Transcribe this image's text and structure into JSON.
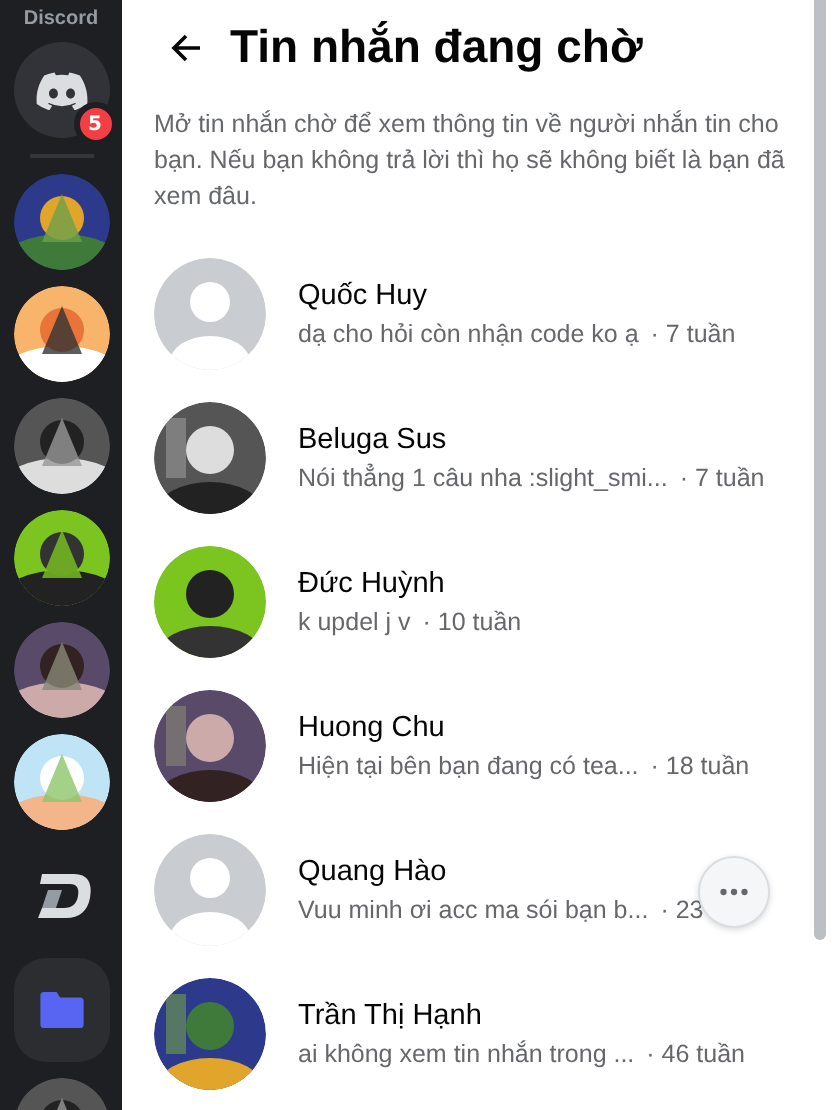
{
  "sidebar": {
    "brand": "Discord",
    "items": [
      {
        "kind": "logo",
        "badge": "5"
      },
      {
        "kind": "picture"
      },
      {
        "kind": "picture"
      },
      {
        "kind": "picture"
      },
      {
        "kind": "picture"
      },
      {
        "kind": "picture"
      },
      {
        "kind": "picture"
      },
      {
        "kind": "d-logo"
      },
      {
        "kind": "folder"
      },
      {
        "kind": "picture"
      }
    ]
  },
  "header": {
    "title": "Tin nhắn đang chờ"
  },
  "description": "Mở tin nhắn chờ để xem thông tin về người nhắn tin cho bạn. Nếu bạn không trả lời thì họ sẽ không biết là bạn đã xem đâu.",
  "requests": [
    {
      "name": "Quốc Huy",
      "kind": "default",
      "preview": "dạ cho hỏi còn nhận code ko ạ",
      "time": "· 7 tuần"
    },
    {
      "name": "Beluga Sus",
      "kind": "picture",
      "preview": "Nói thẳng 1 câu nha :slight_smi...",
      "time": "· 7 tuần"
    },
    {
      "name": "Đức Huỳnh",
      "kind": "picture",
      "preview": "k updel j v",
      "time": "· 10 tuần"
    },
    {
      "name": "Huong Chu",
      "kind": "picture",
      "preview": "Hiện tại bên bạn đang có tea...",
      "time": "· 18 tuần"
    },
    {
      "name": "Quang Hào",
      "kind": "default",
      "preview": "Vuu minh ơi acc ma sói bạn b...",
      "time": "· 23",
      "more": true
    },
    {
      "name": "Trần Thị Hạnh",
      "kind": "picture",
      "preview": "ai không xem tin nhắn trong ...",
      "time": "· 46 tuần"
    }
  ]
}
